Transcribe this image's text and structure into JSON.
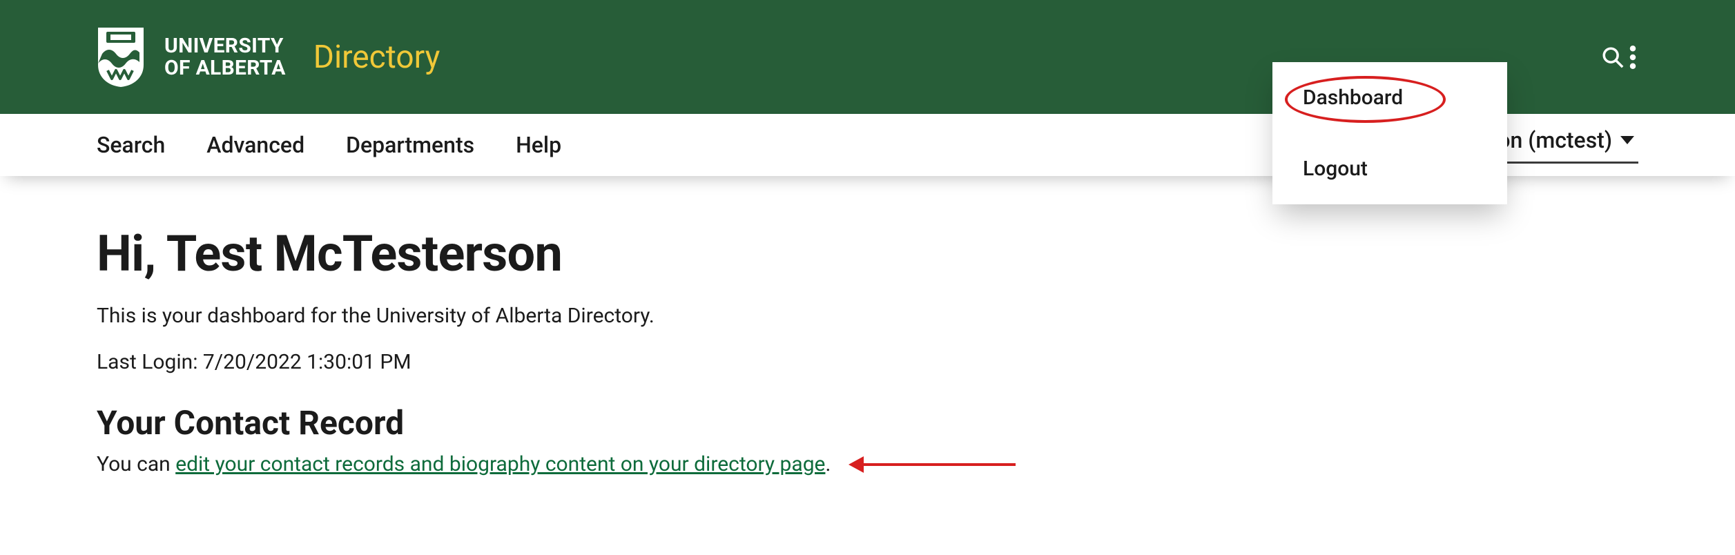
{
  "header": {
    "institution_line1": "UNIVERSITY",
    "institution_line2": "OF ALBERTA",
    "app_title": "Directory"
  },
  "nav": {
    "items": [
      {
        "label": "Search"
      },
      {
        "label": "Advanced"
      },
      {
        "label": "Departments"
      },
      {
        "label": "Help"
      }
    ],
    "user_greeting": "Hi Test McTesterson (mctest)",
    "dropdown": [
      {
        "label": "Dashboard"
      },
      {
        "label": "Logout"
      }
    ]
  },
  "page": {
    "title": "Hi, Test McTesterson",
    "intro": "This is your dashboard for the University of Alberta Directory.",
    "last_login_label": "Last Login: ",
    "last_login_value": "7/20/2022 1:30:01 PM",
    "section_heading": "Your Contact Record",
    "record_prefix": "You can ",
    "record_link": "edit your contact records and biography content on your directory page",
    "record_suffix": "."
  }
}
